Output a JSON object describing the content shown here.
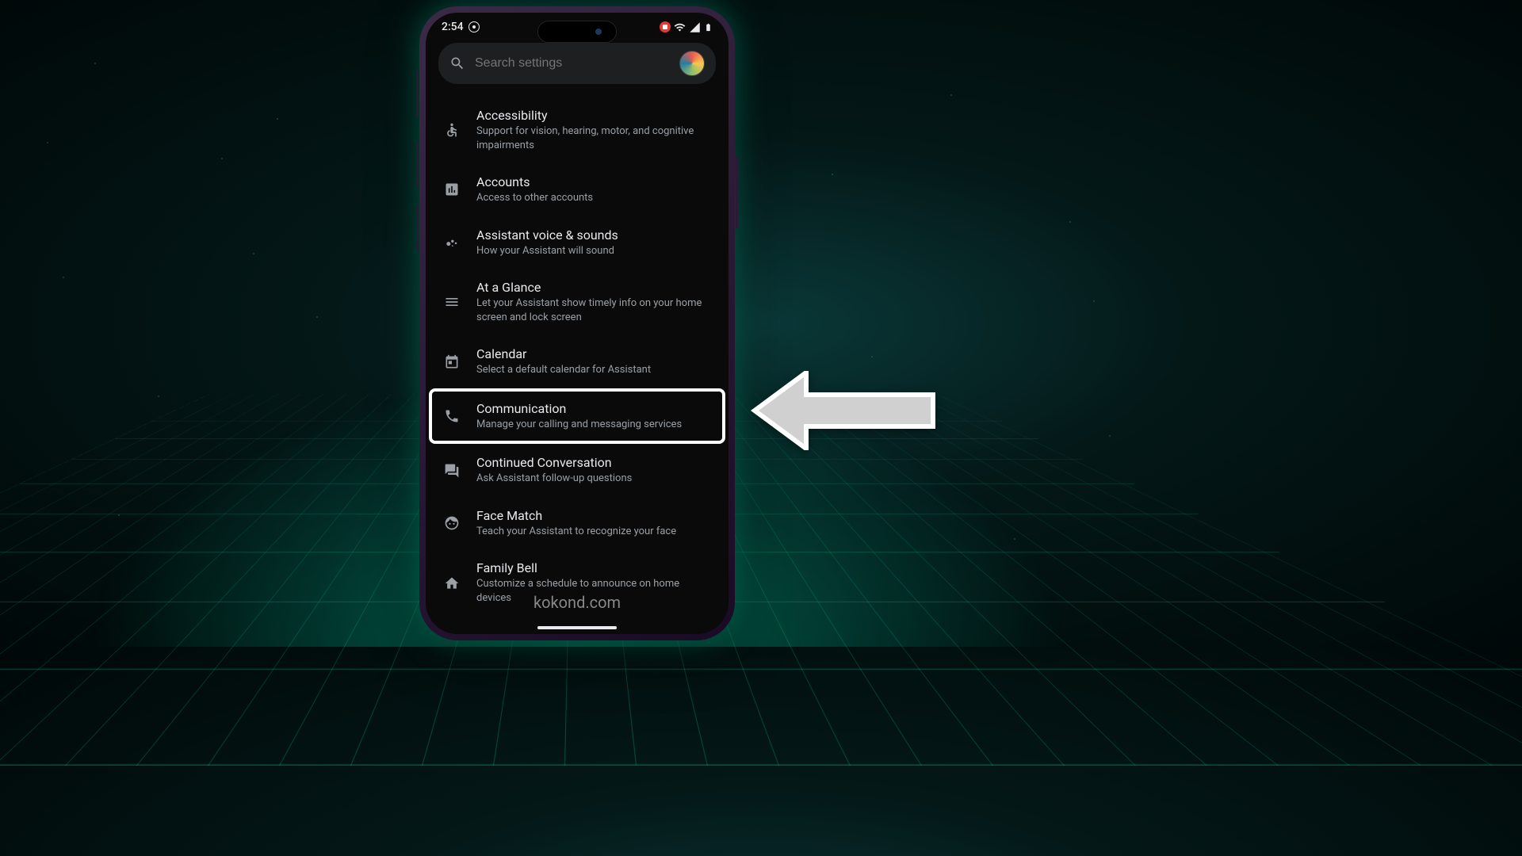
{
  "status": {
    "time": "2:54"
  },
  "search": {
    "placeholder": "Search settings"
  },
  "settings": [
    {
      "id": "accessibility",
      "title": "Accessibility",
      "subtitle": "Support for vision, hearing, motor, and cognitive impairments"
    },
    {
      "id": "accounts",
      "title": "Accounts",
      "subtitle": "Access to other accounts"
    },
    {
      "id": "assistant-voice",
      "title": "Assistant voice & sounds",
      "subtitle": "How your Assistant will sound"
    },
    {
      "id": "at-a-glance",
      "title": "At a Glance",
      "subtitle": "Let your Assistant show timely info on your home screen and lock screen"
    },
    {
      "id": "calendar",
      "title": "Calendar",
      "subtitle": "Select a default calendar for Assistant"
    },
    {
      "id": "communication",
      "title": "Communication",
      "subtitle": "Manage your calling and messaging services",
      "highlighted": true
    },
    {
      "id": "continued-conversation",
      "title": "Continued Conversation",
      "subtitle": "Ask Assistant follow-up questions"
    },
    {
      "id": "face-match",
      "title": "Face Match",
      "subtitle": "Teach your Assistant to recognize your face"
    },
    {
      "id": "family-bell",
      "title": "Family Bell",
      "subtitle": "Customize a schedule to announce on home devices"
    }
  ],
  "watermark": "kokond.com"
}
